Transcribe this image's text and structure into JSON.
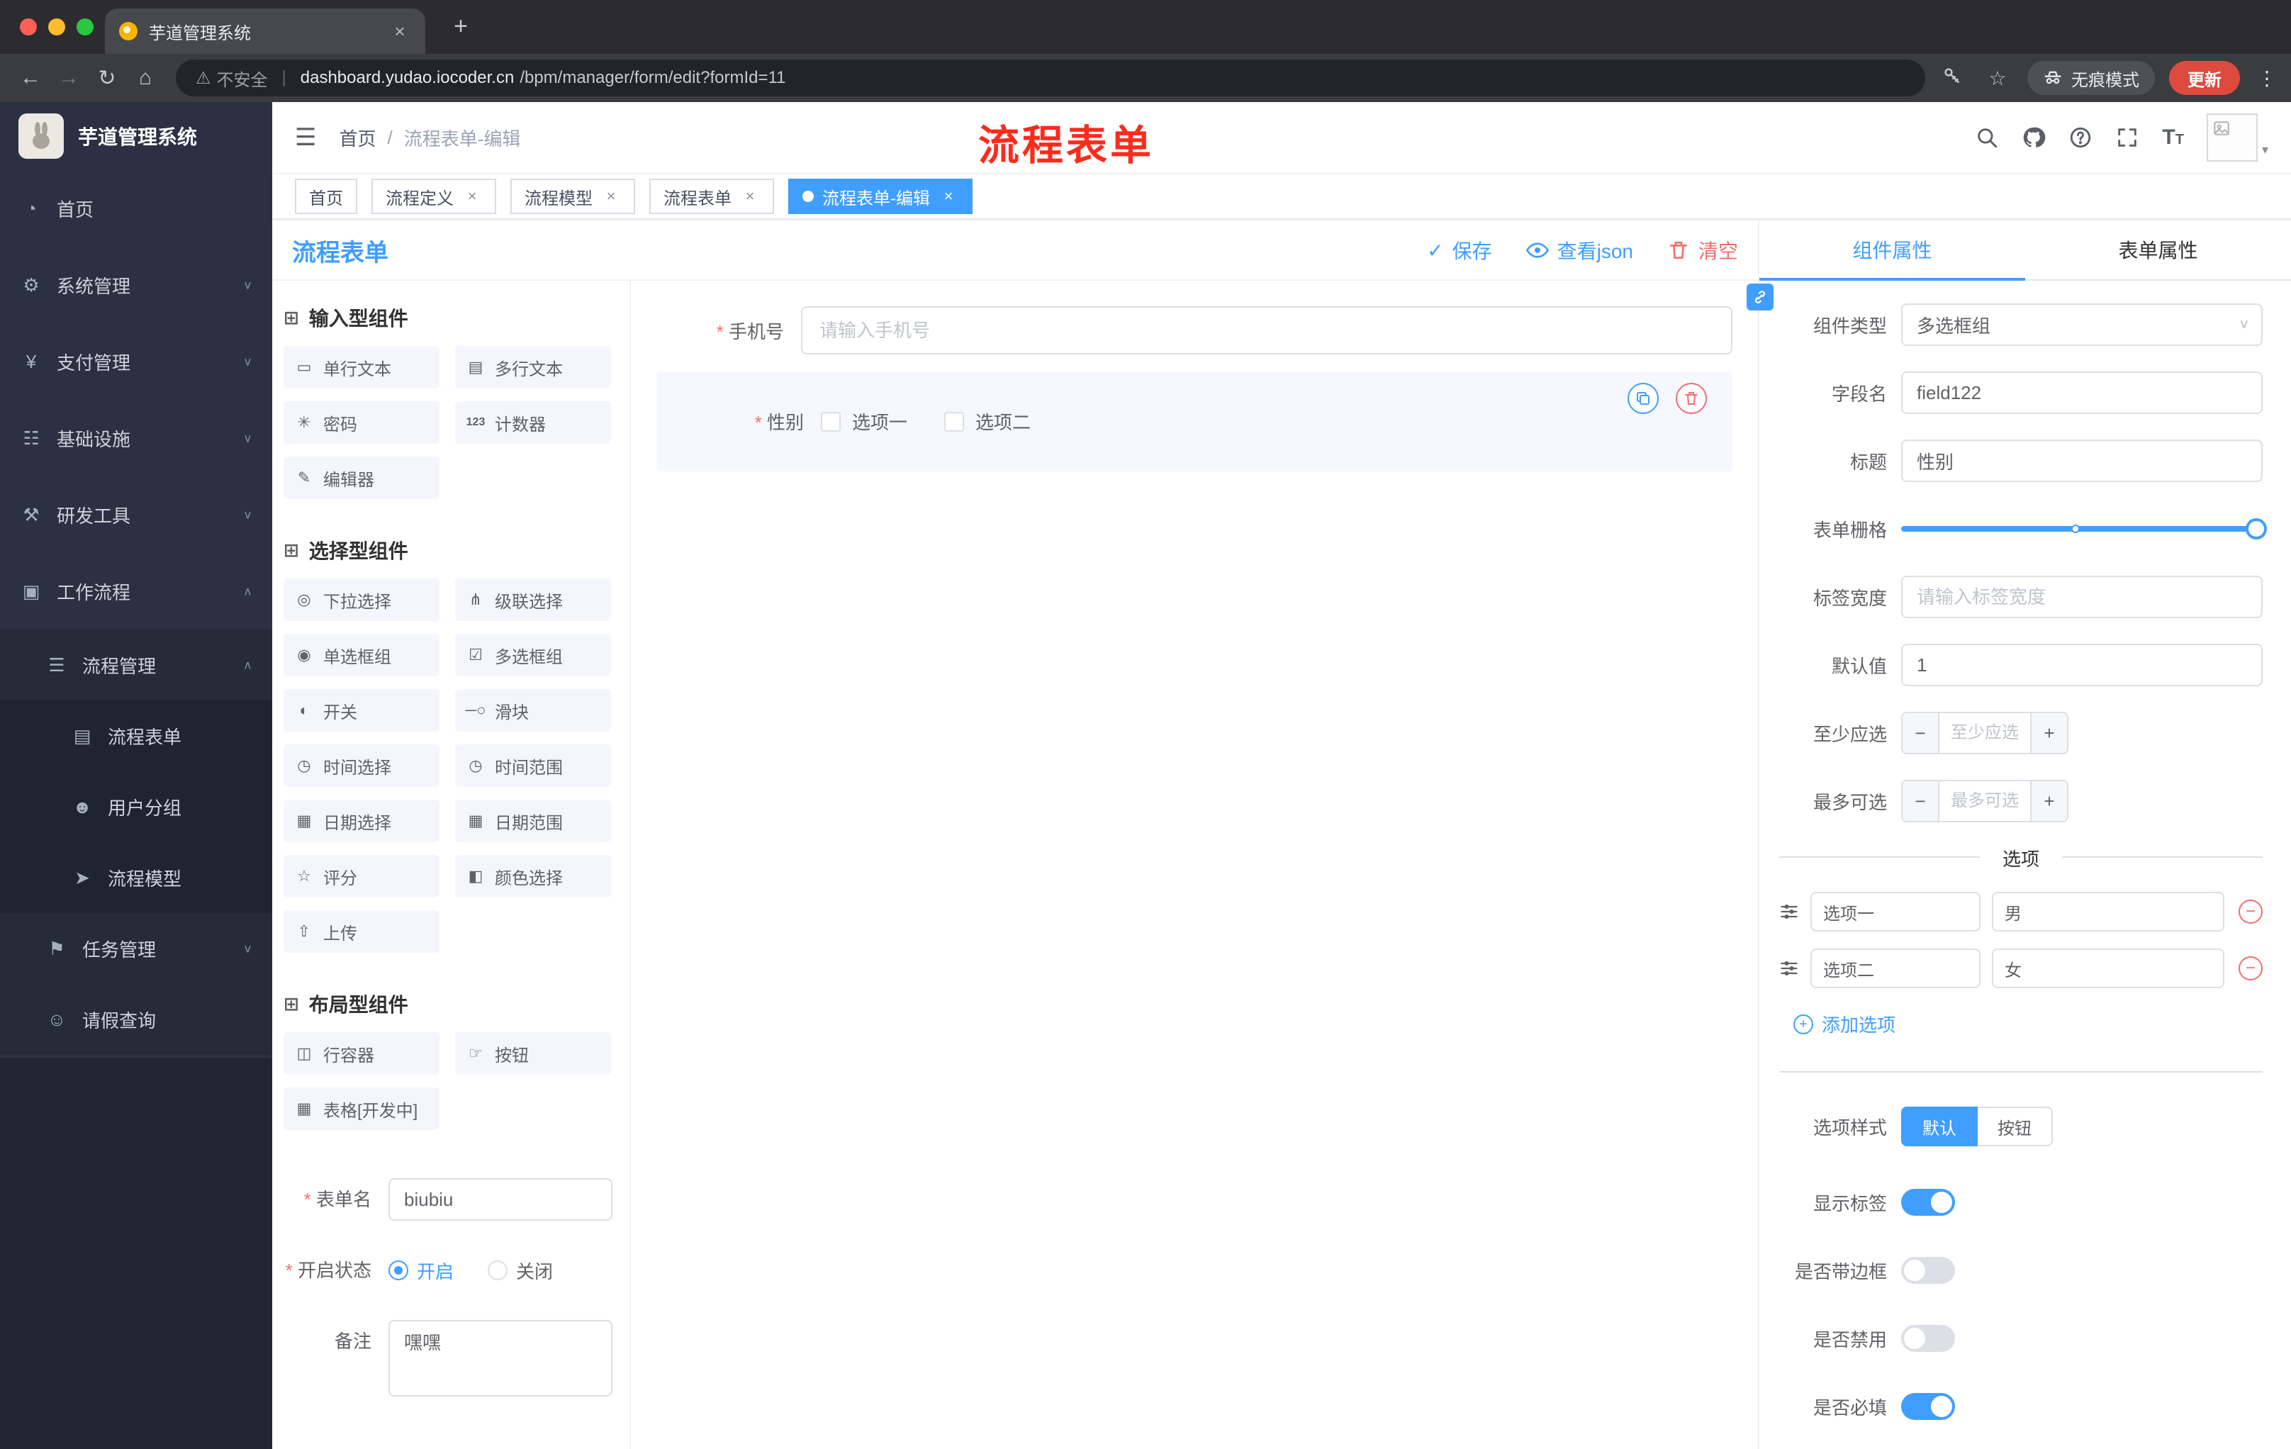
{
  "colors": {
    "accent": "#409eff",
    "danger": "#f56c6c",
    "annotation_red": "#fe2b1c",
    "sidebar_bg": "#2b3142",
    "tag_active_bg": "#409eff",
    "update_button_bg": "#dc4b3e"
  },
  "glyphs": {
    "minus": "−",
    "plus": "+",
    "close": "×",
    "check": "✓",
    "caret_down": "∨",
    "caret_up": "∧",
    "kebab": "⋮",
    "back": "←",
    "forward": "→",
    "reload": "↻",
    "home": "⌂",
    "star": "☆",
    "warning": "⚠",
    "hamburger": "☰",
    "slash": "/",
    "avatar_caret": "▾",
    "new_tab": "+",
    "section": "⊞"
  },
  "browser": {
    "tab_title": "芋道管理系统",
    "security_label": "不安全",
    "url_domain": "dashboard.yudao.iocoder.cn",
    "url_path": "/bpm/manager/form/edit?formId=11",
    "incognito_label": "无痕模式",
    "update_label": "更新"
  },
  "sidebar": {
    "logo_title": "芋道管理系统",
    "items": [
      {
        "label": "首页",
        "glyph": "◔"
      },
      {
        "label": "系统管理",
        "glyph": "⚙"
      },
      {
        "label": "支付管理",
        "glyph": "¥"
      },
      {
        "label": "基础设施",
        "glyph": "☷"
      },
      {
        "label": "研发工具",
        "glyph": "⚒"
      },
      {
        "label": "工作流程",
        "glyph": "▣"
      },
      {
        "label": "流程管理",
        "glyph": "☰"
      },
      {
        "label": "流程表单",
        "glyph": "▤"
      },
      {
        "label": "用户分组",
        "glyph": "☻"
      },
      {
        "label": "流程模型",
        "glyph": "➤"
      },
      {
        "label": "任务管理",
        "glyph": "⚑"
      },
      {
        "label": "请假查询",
        "glyph": "☺"
      }
    ]
  },
  "header": {
    "breadcrumb_home": "首页",
    "breadcrumb_current": "流程表单-编辑",
    "annotation": "流程表单"
  },
  "tags": [
    {
      "label": "首页"
    },
    {
      "label": "流程定义"
    },
    {
      "label": "流程模型"
    },
    {
      "label": "流程表单"
    },
    {
      "label": "流程表单-编辑"
    }
  ],
  "designer": {
    "title": "流程表单",
    "actions": {
      "save": "保存",
      "view_json": "查看json",
      "clear": "清空"
    },
    "palette": {
      "sections": [
        {
          "title": "输入型组件",
          "items": [
            {
              "label": "单行文本",
              "glyph": "▭"
            },
            {
              "label": "多行文本",
              "glyph": "▤"
            },
            {
              "label": "密码",
              "glyph": "✳"
            },
            {
              "label": "计数器",
              "glyph": "123"
            },
            {
              "label": "编辑器",
              "glyph": "✎"
            }
          ]
        },
        {
          "title": "选择型组件",
          "items": [
            {
              "label": "下拉选择",
              "glyph": "◎"
            },
            {
              "label": "级联选择",
              "glyph": "⋔"
            },
            {
              "label": "单选框组",
              "glyph": "◉"
            },
            {
              "label": "多选框组",
              "glyph": "☑"
            },
            {
              "label": "开关",
              "glyph": "◐"
            },
            {
              "label": "滑块",
              "glyph": "─○"
            },
            {
              "label": "时间选择",
              "glyph": "◷"
            },
            {
              "label": "时间范围",
              "glyph": "◷"
            },
            {
              "label": "日期选择",
              "glyph": "▦"
            },
            {
              "label": "日期范围",
              "glyph": "▦"
            },
            {
              "label": "评分",
              "glyph": "☆"
            },
            {
              "label": "颜色选择",
              "glyph": "◧"
            },
            {
              "label": "上传",
              "glyph": "⇧"
            }
          ]
        },
        {
          "title": "布局型组件",
          "items": [
            {
              "label": "行容器",
              "glyph": "◫"
            },
            {
              "label": "按钮",
              "glyph": "☞"
            },
            {
              "label": "表格[开发中]",
              "glyph": "▦"
            }
          ]
        }
      ],
      "form": {
        "name_label": "表单名",
        "name_value": "biubiu",
        "status_label": "开启状态",
        "status_on": "开启",
        "status_off": "关闭",
        "remark_label": "备注",
        "remark_value": "嘿嘿"
      }
    },
    "canvas": {
      "phone_label": "手机号",
      "phone_placeholder": "请输入手机号",
      "gender_label": "性别",
      "gender_options": [
        "选项一",
        "选项二"
      ]
    },
    "props": {
      "tabs": {
        "component": "组件属性",
        "form": "表单属性"
      },
      "type_label": "组件类型",
      "type_value": "多选框组",
      "field_label": "字段名",
      "field_value": "field122",
      "title_label": "标题",
      "title_value": "性别",
      "grid_label": "表单栅格",
      "label_width_label": "标签宽度",
      "label_width_placeholder": "请输入标签宽度",
      "default_label": "默认值",
      "default_value": "1",
      "min_label": "至少应选",
      "min_placeholder": "至少应选",
      "max_label": "最多可选",
      "max_placeholder": "最多可选",
      "options_title": "选项",
      "options": [
        {
          "label": "选项一",
          "value": "男"
        },
        {
          "label": "选项二",
          "value": "女"
        }
      ],
      "add_option_label": "添加选项",
      "style_label": "选项样式",
      "style_default": "默认",
      "style_button": "按钮",
      "toggles": {
        "show_label": "显示标签",
        "border": "是否带边框",
        "disabled": "是否禁用",
        "required": "是否必填"
      }
    }
  }
}
